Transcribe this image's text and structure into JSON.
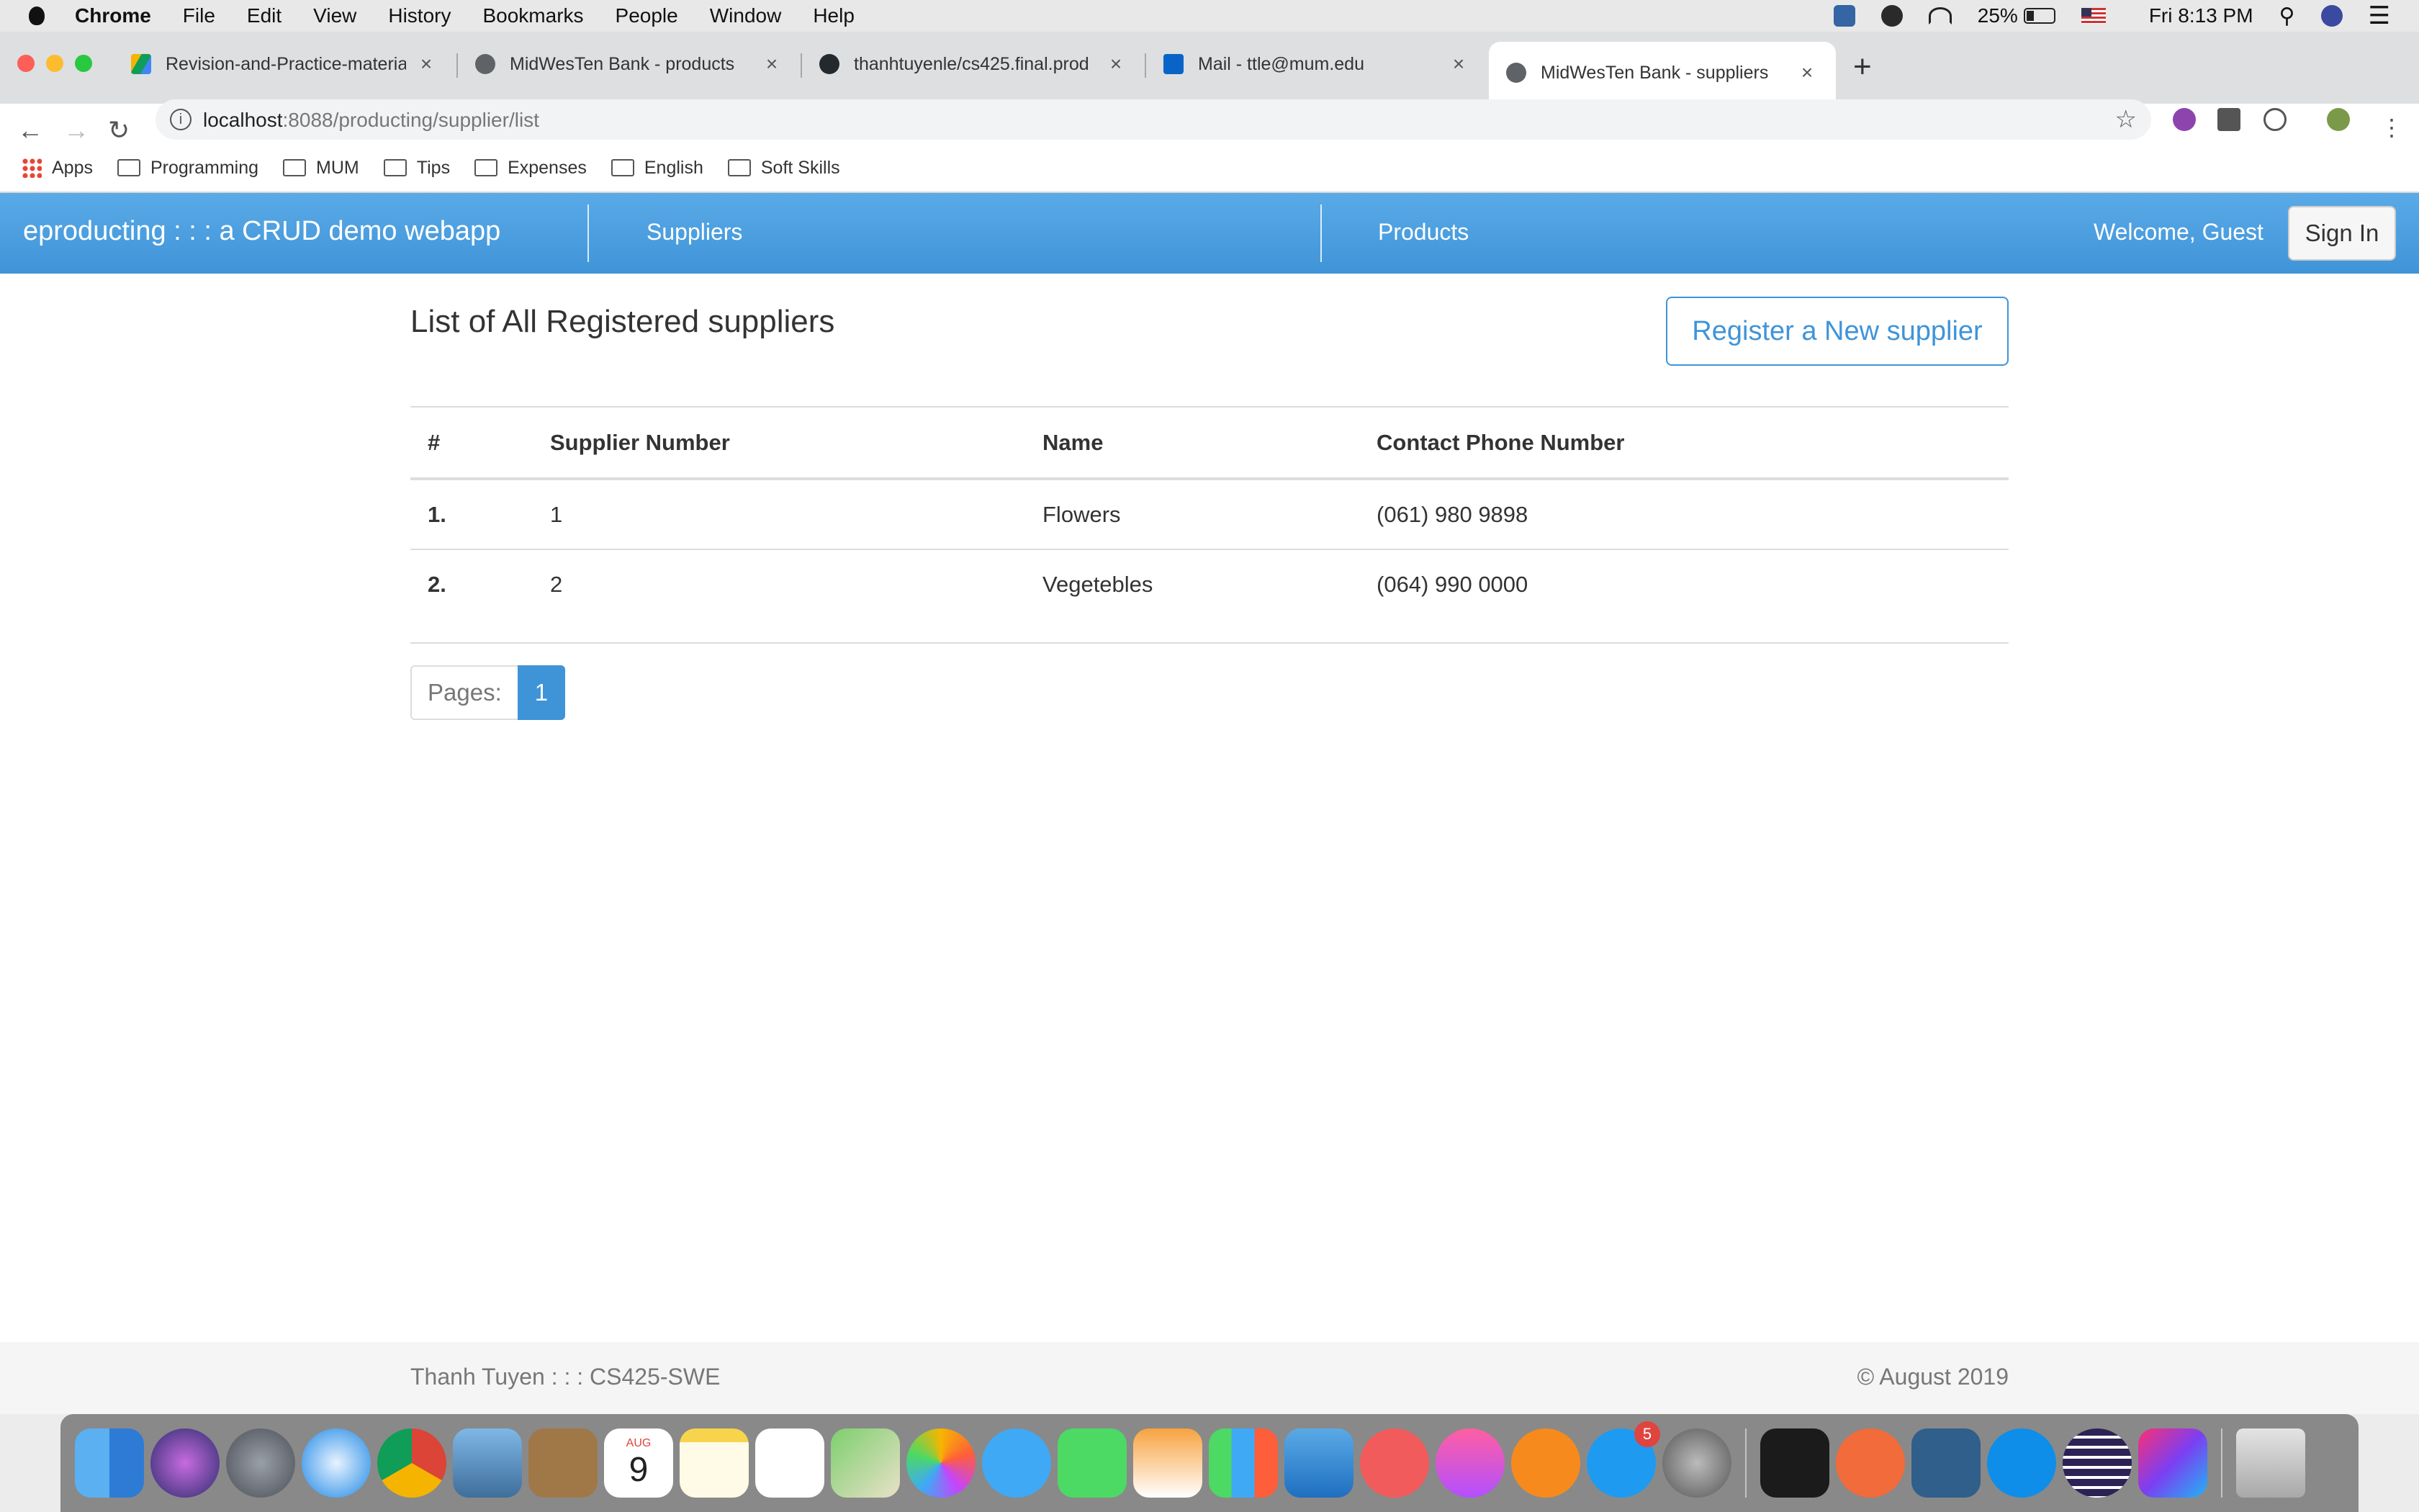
{
  "menubar": {
    "items": [
      "Chrome",
      "File",
      "Edit",
      "View",
      "History",
      "Bookmarks",
      "People",
      "Window",
      "Help"
    ],
    "battery": "25%",
    "clock": "Fri 8:13 PM"
  },
  "tabs": [
    {
      "title": "Revision-and-Practice-materia",
      "icon": "google-drive-icon"
    },
    {
      "title": "MidWesTen Bank - products",
      "icon": "globe-icon"
    },
    {
      "title": "thanhtuyenle/cs425.final.prod",
      "icon": "github-icon"
    },
    {
      "title": "Mail - ttle@mum.edu",
      "icon": "outlook-icon"
    },
    {
      "title": "MidWesTen Bank - suppliers",
      "icon": "globe-icon",
      "active": true
    }
  ],
  "address": {
    "host": "localhost",
    "path": ":8088/producting/supplier/list"
  },
  "bookmarks": [
    "Apps",
    "Programming",
    "MUM",
    "Tips",
    "Expenses",
    "English",
    "Soft Skills"
  ],
  "navbar": {
    "brand": "eproducting : : : a CRUD demo webapp",
    "links": [
      "Suppliers",
      "Products"
    ],
    "welcome": "Welcome, Guest",
    "signin": "Sign In"
  },
  "main": {
    "heading": "List of All Registered suppliers",
    "register_button": "Register a New supplier",
    "table": {
      "headers": [
        "#",
        "Supplier Number",
        "Name",
        "Contact Phone Number"
      ],
      "rows": [
        {
          "index": "1.",
          "number": "1",
          "name": "Flowers",
          "phone": "(061) 980 9898"
        },
        {
          "index": "2.",
          "number": "2",
          "name": "Vegetebles",
          "phone": "(064) 990 0000"
        }
      ]
    },
    "pager": {
      "label": "Pages:",
      "current": "1"
    }
  },
  "footer": {
    "left": "Thanh Tuyen : : : CS425-SWE",
    "right": "© August 2019"
  },
  "dock": {
    "apps": [
      "finder",
      "siri",
      "launchpad",
      "safari",
      "chrome",
      "preview",
      "contacts",
      "calendar",
      "notes",
      "reminders",
      "maps",
      "photos",
      "messages",
      "facetime",
      "pages",
      "numbers",
      "keynote",
      "news",
      "itunes",
      "books",
      "app-store",
      "system-preferences",
      "terminal",
      "sketch",
      "mysql-workbench",
      "teamviewer",
      "eclipse",
      "intellij",
      "trash"
    ],
    "calendar_month": "AUG",
    "calendar_day": "9",
    "app_store_badge": "5"
  },
  "colors": {
    "navbar_top": "#5aaae7",
    "navbar_bottom": "#3f94d8",
    "accent": "#3f94d8"
  }
}
